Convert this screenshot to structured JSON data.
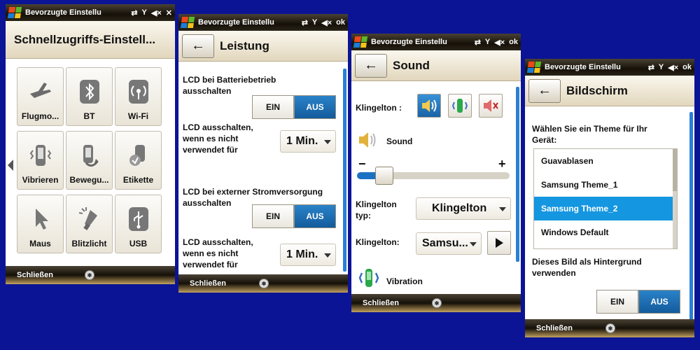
{
  "status_bar_title": "Bevorzugte Einstellu",
  "bottom_bar": {
    "close_label": "Schließen",
    "keyboard_label": "✱"
  },
  "close_x": "✕",
  "ok_label": "ok",
  "screen1": {
    "title": "Schnellzugriffs-Einstell...",
    "tiles": [
      {
        "label": "Flugmo...",
        "icon": "airplane-icon"
      },
      {
        "label": "BT",
        "icon": "bluetooth-icon"
      },
      {
        "label": "Wi-Fi",
        "icon": "wifi-icon"
      },
      {
        "label": "Vibrieren",
        "icon": "vibrate-icon"
      },
      {
        "label": "Bewegu...",
        "icon": "motion-icon"
      },
      {
        "label": "Etikette",
        "icon": "etiquette-icon"
      },
      {
        "label": "Maus",
        "icon": "mouse-cursor-icon"
      },
      {
        "label": "Blitzlicht",
        "icon": "flashlight-icon"
      },
      {
        "label": "USB",
        "icon": "usb-icon"
      }
    ]
  },
  "screen2": {
    "title": "Leistung",
    "lcd_battery_label": "LCD bei Batteriebetrieb ausschalten",
    "lcd_battery_on": "EIN",
    "lcd_battery_off": "AUS",
    "lcd_battery_selected": "AUS",
    "lcd_timeout_label": "LCD ausschalten, wenn es nicht verwendet für",
    "lcd_timeout_value": "1 Min.",
    "lcd_external_label": "LCD bei externer Stromversorgung ausschalten",
    "lcd_external_on": "EIN",
    "lcd_external_off": "AUS",
    "lcd_external_selected": "AUS",
    "lcd_timeout2_label": "LCD ausschalten, wenn es nicht verwendet für",
    "lcd_timeout2_value": "1 Min."
  },
  "screen3": {
    "title": "Sound",
    "klingelton_label": "Klingelton :",
    "sound_label": "Sound",
    "minus": "−",
    "plus": "+",
    "volume_fraction": 0.18,
    "klingelton_typ_label": "Klingelton typ:",
    "klingelton_typ_value": "Klingelton",
    "klingelton2_label": "Klingelton:",
    "klingelton2_value": "Samsu...",
    "vibration_label": "Vibration"
  },
  "screen4": {
    "title": "Bildschirm",
    "theme_prompt": "Wählen Sie ein Theme für Ihr Gerät:",
    "themes": [
      "Guavablasen",
      "Samsung Theme_1",
      "Samsung Theme_2",
      "Windows Default"
    ],
    "selected_theme": "Samsung Theme_2",
    "wallpaper_label": "Dieses Bild als Hintergrund verwenden",
    "wallpaper_on": "EIN",
    "wallpaper_off": "AUS",
    "wallpaper_selected": "AUS"
  },
  "colors": {
    "background": "#0b1495",
    "accent": "#1596e0",
    "toggle_on": "#135b9c"
  }
}
